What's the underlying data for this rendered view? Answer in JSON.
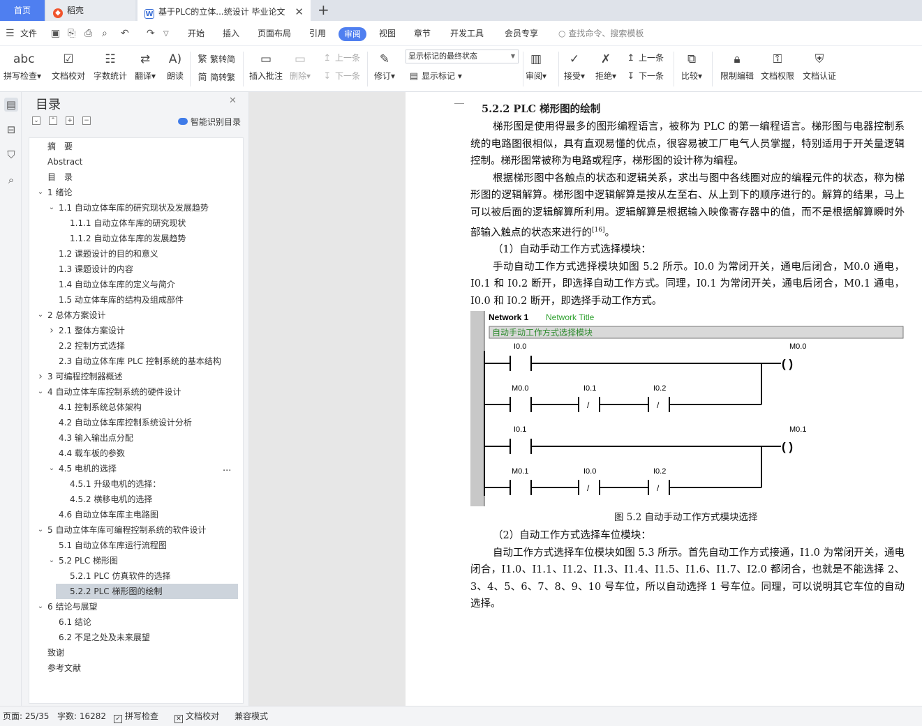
{
  "tabs": {
    "home": "首页",
    "daoke": "稻壳",
    "doc": "基于PLC的立体...统设计 毕业论文"
  },
  "menu": {
    "file": "文件",
    "items": [
      "开始",
      "插入",
      "页面布局",
      "引用",
      "审阅",
      "视图",
      "章节",
      "开发工具",
      "会员专享"
    ],
    "active": "审阅",
    "search": "查找命令、搜索模板"
  },
  "ribbon": {
    "spell_check": "拼写检查",
    "doc_check": "文档校对",
    "word_count": "字数统计",
    "translate": "翻译",
    "read_aloud": "朗读",
    "trad_simp": "繁转简",
    "simp_trad": "简转繁",
    "insert_comment": "插入批注",
    "delete": "删除",
    "prev": "上一条",
    "next": "下一条",
    "revise": "修订",
    "track_select": "显示标记的最终状态",
    "show_markup": "显示标记",
    "review": "审阅",
    "accept": "接受",
    "reject": "拒绝",
    "prev2": "上一条",
    "next2": "下一条",
    "compare": "比较",
    "restrict_edit": "限制编辑",
    "doc_rights": "文档权限",
    "doc_auth": "文档认证"
  },
  "toc": {
    "title": "目录",
    "smart": "智能识别目录",
    "items": [
      {
        "label": "摘　要"
      },
      {
        "label": "Abstract"
      },
      {
        "label": "目　录"
      },
      {
        "label": "1  绪论",
        "arrow": "v"
      },
      {
        "label": "1.1 自动立体车库的研究现状及发展趋势",
        "arrow": "v"
      },
      {
        "label": "1.1.1  自动立体车库的研究现状"
      },
      {
        "label": "1.1.2  自动立体车库的发展趋势"
      },
      {
        "label": "1.2  课题设计的目的和意义"
      },
      {
        "label": "1.3  课题设计的内容"
      },
      {
        "label": "1.4  自动立体车库的定义与简介"
      },
      {
        "label": "1.5  动立体车库的结构及组成部件"
      },
      {
        "label": "2  总体方案设计",
        "arrow": "v"
      },
      {
        "label": "2.1  整体方案设计",
        "arrow": ">"
      },
      {
        "label": "2.2  控制方式选择"
      },
      {
        "label": "2.3 自动立体车库 PLC 控制系统的基本结构"
      },
      {
        "label": "3  可编程控制器概述",
        "arrow": ">"
      },
      {
        "label": "4  自动立体车库控制系统的硬件设计",
        "arrow": "v"
      },
      {
        "label": "4.1  控制系统总体架构"
      },
      {
        "label": "4.2  自动立体车库控制系统设计分析"
      },
      {
        "label": "4.3  输入输出点分配"
      },
      {
        "label": "4.4  载车板的参数"
      },
      {
        "label": "4.5  电机的选择",
        "arrow": "v"
      },
      {
        "label": "4.5.1  升级电机的选择："
      },
      {
        "label": "4.5.2  横移电机的选择"
      },
      {
        "label": "4.6  自动立体车库主电路图"
      },
      {
        "label": "5  自动立体车库可编程控制系统的软件设计",
        "arrow": "v"
      },
      {
        "label": "5.1  自动立体车库运行流程图"
      },
      {
        "label": "5.2 PLC 梯形图",
        "arrow": "v"
      },
      {
        "label": "5.2.1 PLC 仿真软件的选择"
      },
      {
        "label": "5.2.2 PLC 梯形图的绘制"
      },
      {
        "label": "6  结论与展望",
        "arrow": "v"
      },
      {
        "label": "6.1  结论"
      },
      {
        "label": "6.2  不足之处及未来展望"
      },
      {
        "label": "致谢"
      },
      {
        "label": "参考文献"
      }
    ],
    "more": "..."
  },
  "document": {
    "section_heading": "5.2.2 PLC 梯形图的绘制",
    "para1": "梯形图是使用得最多的图形编程语言，被称为 PLC 的第一编程语言。梯形图与电器控制系统的电路图很相似，具有直观易懂的优点，很容易被工厂电气人员掌握，特别适用于开关量逻辑控制。梯形图常被称为电路或程序，梯形图的设计称为编程。",
    "para2": "根据梯形图中各触点的状态和逻辑关系，求出与图中各线圈对应的编程元件的状态，称为梯形图的逻辑解算。梯形图中逻辑解算是按从左至右、从上到下的顺序进行的。解算的结果，马上可以被后面的逻辑解算所利用。逻辑解算是根据输入映像寄存器中的值，而不是根据解算瞬时外部输入触点的状态来进行的",
    "para2_ref": "[16]",
    "para2_end": "。",
    "item1": "（1）自动手动工作方式选择模块：",
    "para3": "手动自动工作方式选择模块如图 5.2 所示。I0.0 为常闭开关，通电后闭合，M0.0 通电，I0.1 和 I0.2 断开，即选择自动工作方式。同理，I0.1 为常闭开关，通电后闭合，M0.1 通电，I0.0 和 I0.2 断开，即选择手动工作方式。",
    "figure_caption": "图 5.2  自动手动工作方式模块选择",
    "item2": "（2）自动工作方式选择车位模块：",
    "para4": "自动工作方式选择车位模块如图 5.3 所示。首先自动工作方式接通，I1.0 为常闭开关，通电闭合，I1.0、I1.1、I1.2、I1.3、I1.4、I1.5、I1.6、I1.7、I2.0 都闭合，也就是不能选择 2、3、4、5、6、7、8、9、10 号车位，所以自动选择 1 号车位。同理，可以说明其它车位的自动选择。"
  },
  "ladder": {
    "network": "Network 1",
    "network_title": "Network Title",
    "comment": "自动手动工作方式选择模块",
    "rung1_contact": "I0.0",
    "rung1_coil": "M0.0",
    "rung2_c1": "M0.0",
    "rung2_c2": "I0.1",
    "rung2_c3": "I0.2",
    "rung3_contact": "I0.1",
    "rung3_coil": "M0.1",
    "rung4_c1": "M0.1",
    "rung4_c2": "I0.0",
    "rung4_c3": "I0.2",
    "coil_text": "(    )",
    "slash": "/"
  },
  "status": {
    "page": "页面: 25/35",
    "words": "字数: 16282",
    "spell": "拼写检查",
    "proof": "文档校对",
    "compat": "兼容模式"
  }
}
